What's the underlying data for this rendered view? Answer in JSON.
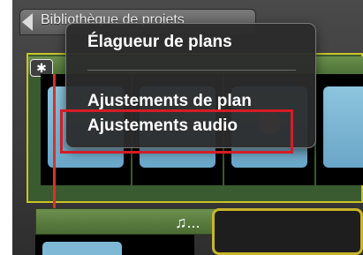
{
  "header": {
    "tab_label": "Bibliothèque de projets"
  },
  "clip": {
    "gear_icon_glyph": "✱"
  },
  "audio": {
    "label": "♫..."
  },
  "menu": {
    "items": [
      {
        "label": "Élagueur de plans"
      },
      {
        "label": "Ajustements de plan"
      },
      {
        "label": "Ajustements audio"
      }
    ]
  },
  "colors": {
    "highlight": "#d51d24",
    "clip_border": "#c8c42a",
    "playhead": "#d6332b"
  }
}
